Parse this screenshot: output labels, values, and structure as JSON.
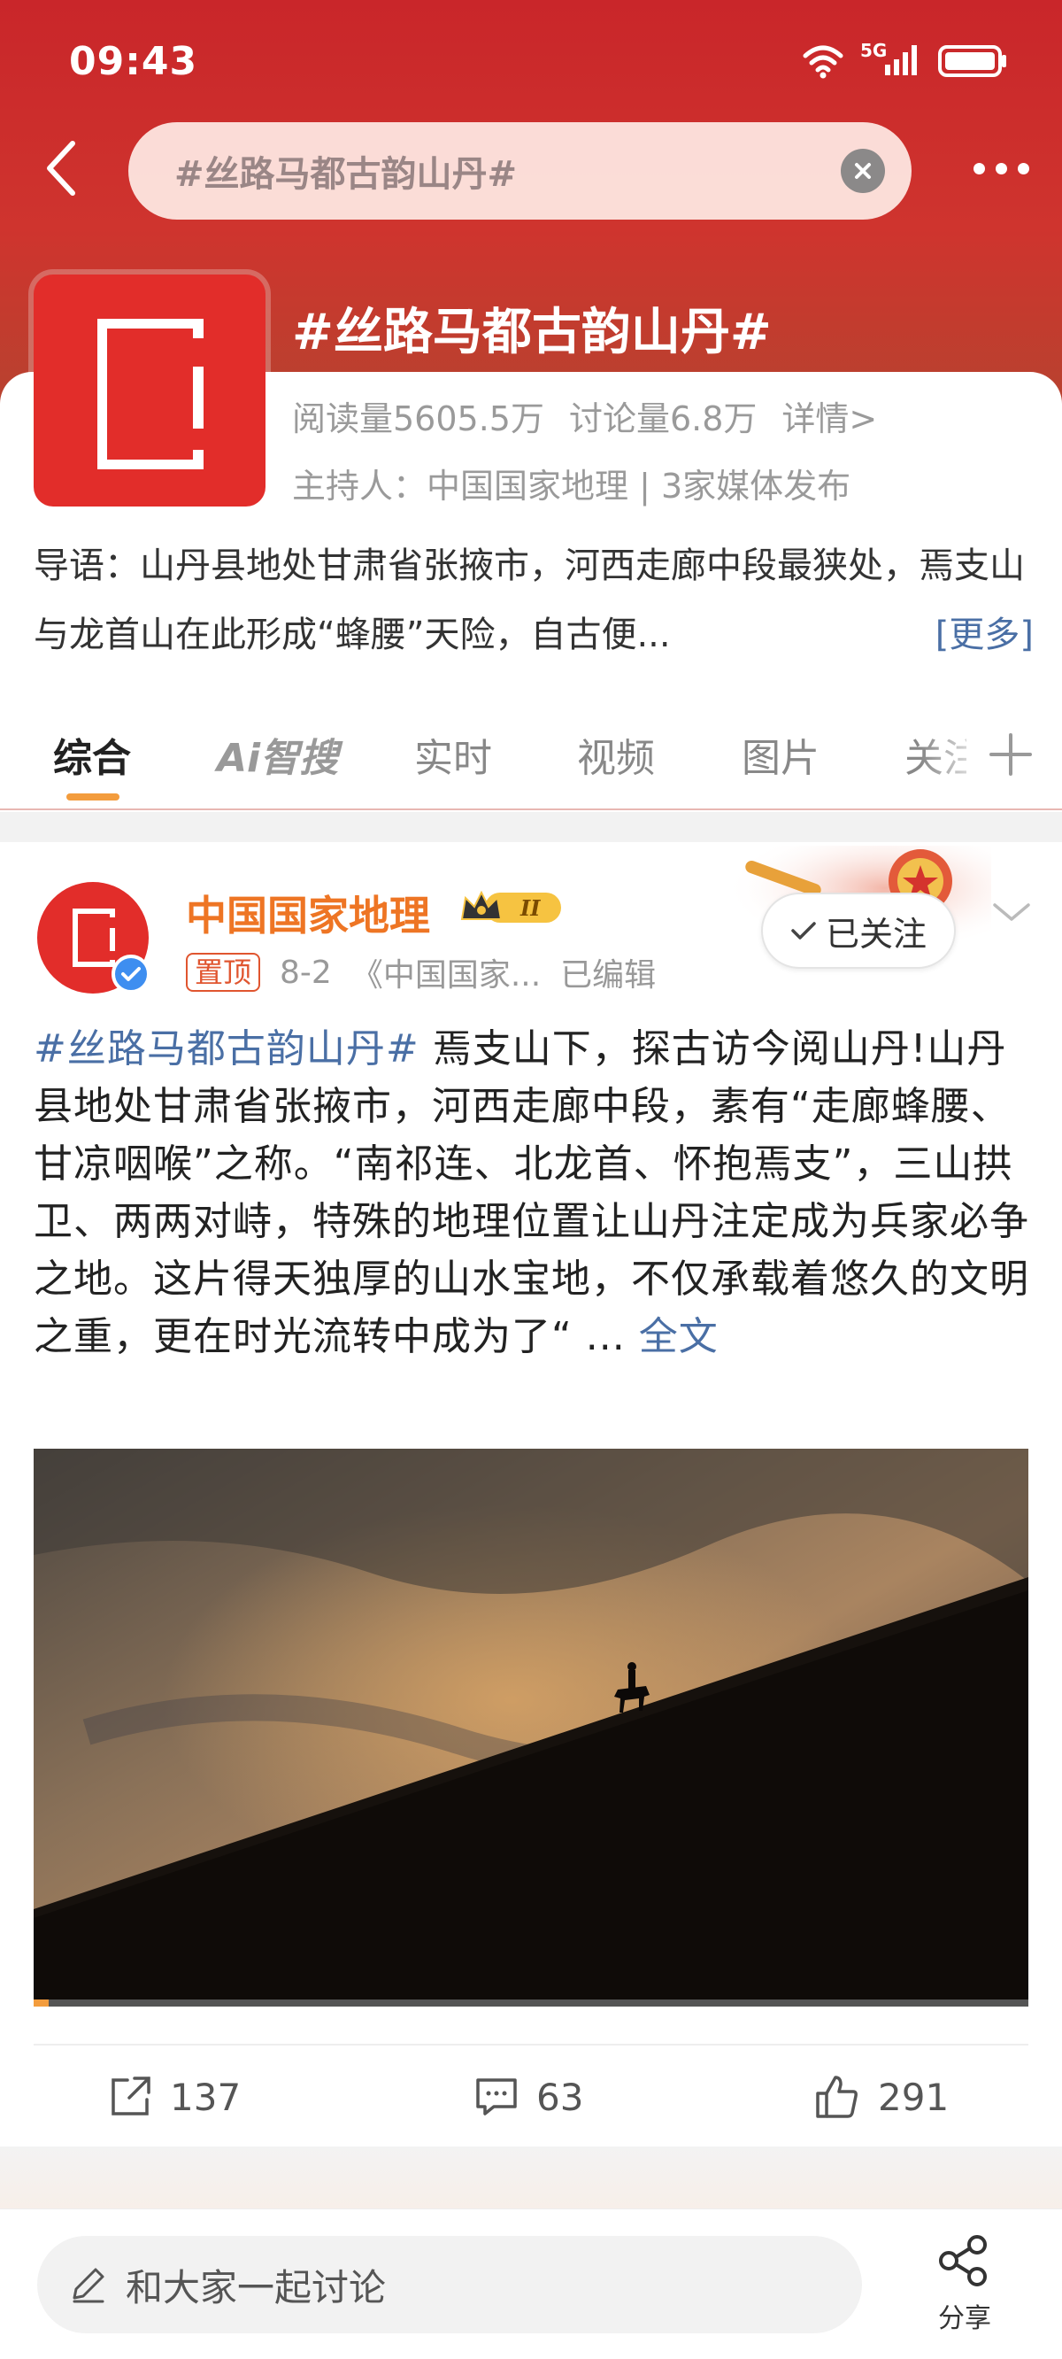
{
  "status_bar": {
    "time": "09:43",
    "network": "5G"
  },
  "search": {
    "query": "#丝路马都古韵山丹#"
  },
  "topic": {
    "title": "#丝路马都古韵山丹#",
    "reads": "阅读量5605.5万",
    "discussions": "讨论量6.8万",
    "details": "详情>",
    "host": "主持人：中国国家地理 | 3家媒体发布",
    "intro": "导语：山丹县地处甘肃省张掖市，河西走廊中段最狭处，焉支山与龙首山在此形成“蜂腰”天险，自古便...",
    "more": "[更多]"
  },
  "tabs": [
    "综合",
    "Ai智搜",
    "实时",
    "视频",
    "图片",
    "关注"
  ],
  "post": {
    "author": "中国国家地理",
    "badge": "II",
    "pinned": "置顶",
    "date": "8-2",
    "source": "《中国国家...",
    "edited": "已编辑",
    "follow": "已关注",
    "hashtag": "#丝路马都古韵山丹#",
    "body": " 焉支山下，探古访今阅山丹!山丹县地处甘肃省张掖市，河西走廊中段，素有“走廊蜂腰、甘凉咽喉”之称。“南祁连、北龙首、怀抱焉支”，三山拱卫、两两对峙，特殊的地理位置让山丹注定成为兵家必争之地。这片得天独厚的山水宝地，不仅承载着悠久的文明之重，更在时光流转中成为了“ ...",
    "fulltext": "全文",
    "video_progress": 0.015,
    "reposts": "137",
    "comments": "63",
    "likes": "291"
  },
  "bottom_bar": {
    "comment_placeholder": "和大家一起讨论",
    "share_label": "分享"
  },
  "colors": {
    "brand_red": "#e22d2a",
    "header_red": "#c9262a",
    "link_blue": "#4a6fa5",
    "author_orange": "#ee7524",
    "accent_orange": "#f39c3d"
  }
}
